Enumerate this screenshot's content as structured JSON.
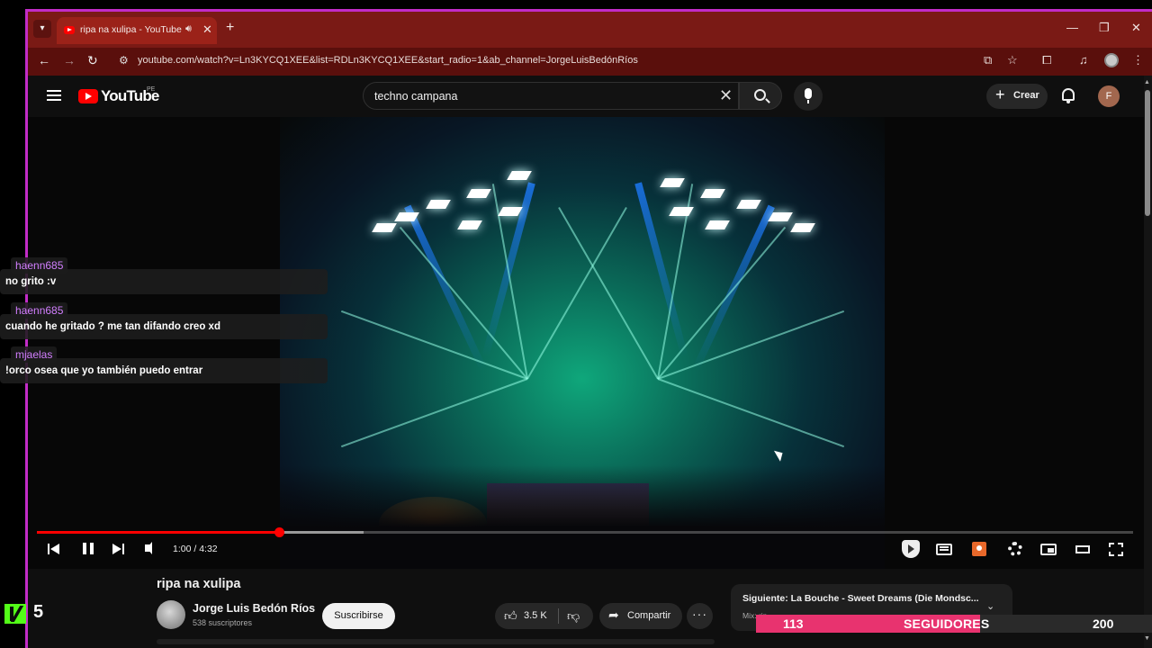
{
  "browser": {
    "tab_title": "ripa na xulipa - YouTube",
    "url": "youtube.com/watch?v=Ln3KYCQ1XEE&list=RDLn3KYCQ1XEE&start_radio=1&ab_channel=JorgeLuisBedónRíos",
    "icons": [
      "tab-menu-icon",
      "speaker-icon",
      "close-icon",
      "plus-icon",
      "minimize-icon",
      "restore-icon",
      "back-icon",
      "forward-icon",
      "reload-icon",
      "site-info-icon",
      "install-icon",
      "star-icon",
      "extensions-icon",
      "media-icon",
      "profile-icon",
      "kebab-icon"
    ]
  },
  "youtube": {
    "logo_text": "YouTube",
    "region": "PE",
    "search": {
      "value": "techno campana"
    },
    "create_label": "Crear",
    "user_initial": "F"
  },
  "player": {
    "time": "1:00 / 4:32",
    "progress": {
      "current_seconds": 60,
      "total_seconds": 272,
      "buffered_seconds": 81
    },
    "accent_color": "#ff0000"
  },
  "video": {
    "title": "ripa na xulipa",
    "channel_name": "Jorge Luis Bedón Ríos",
    "subscribers": "538 suscriptores",
    "subscribe_label": "Suscribirse",
    "likes": "3.5 K",
    "share_label": "Compartir",
    "more_label": "···"
  },
  "up_next": {
    "title": "Siguiente: La Bouche - Sweet Dreams (Die Mondsc...",
    "subtitle": "Mix: rip..."
  },
  "chat": {
    "messages": [
      {
        "user": "haenn685",
        "text": "no grito :v"
      },
      {
        "user": "haenn685",
        "text": "cuando he gritado ? me tan difando creo xd"
      },
      {
        "user": "mjaelas",
        "text": "!orco osea que yo también puedo entrar"
      }
    ],
    "username_color": "#d27fff"
  },
  "kick": {
    "count": "5",
    "brand_color": "#53fc18"
  },
  "followers_goal": {
    "current": 113,
    "label": "SEGUIDORES",
    "target": 200,
    "bar_color": "#e8336f"
  }
}
